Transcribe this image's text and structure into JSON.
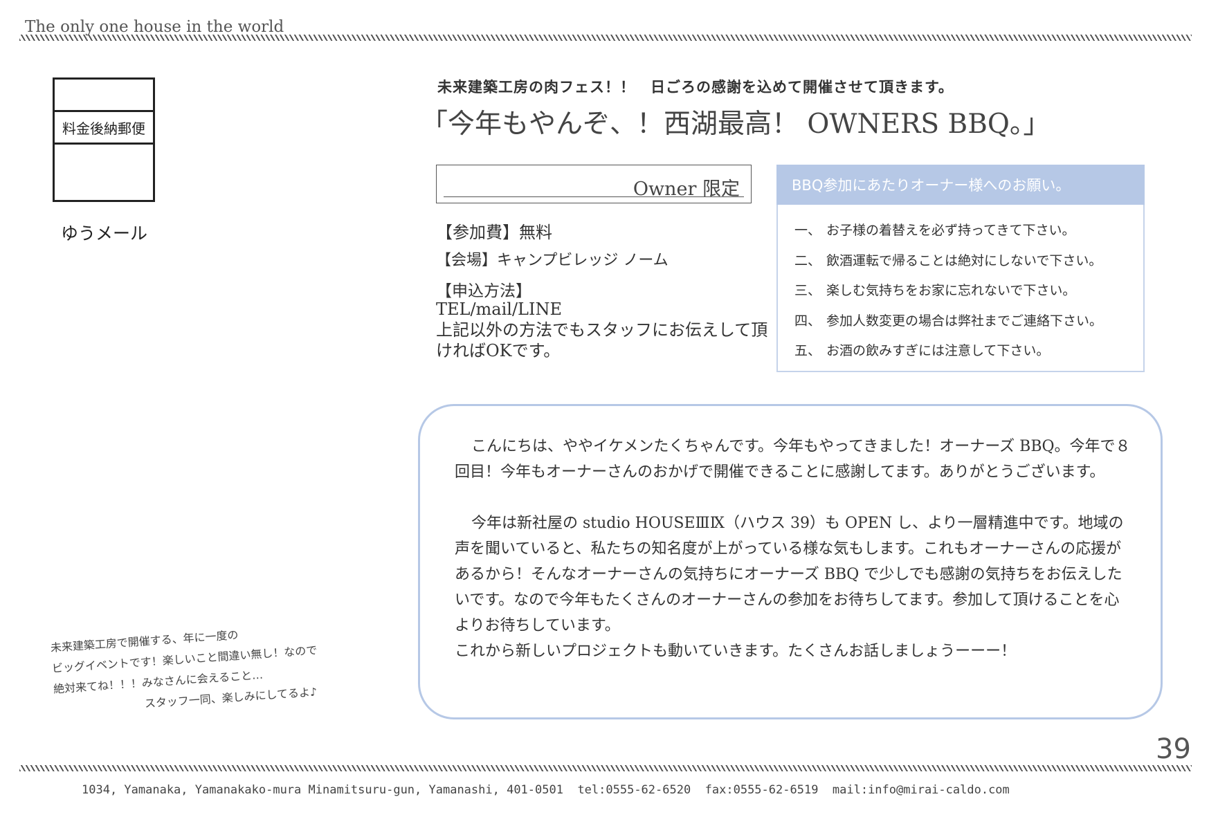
{
  "header": {
    "tagline": "The only one house in the world"
  },
  "postal": {
    "band_label": "料金後納郵便",
    "service_label": "ゆうメール"
  },
  "event": {
    "subtitle": "未来建築工房の肉フェス！！　日ごろの感謝を込めて開催させて頂きます。",
    "title": "「今年もやんぞ、！西湖最高！ OWNERS BBQ。」",
    "owner_label": "Owner 限定",
    "fee": "【参加費】無料",
    "venue": "【会場】キャンプビレッジ ノーム",
    "method_heading": "【申込方法】",
    "method_lines": [
      "TEL/mail/LINE",
      "上記以外の方法でもスタッフにお伝えして頂",
      "ければOKです。"
    ]
  },
  "requests": {
    "heading": "BBQ参加にあたりオーナー様へのお願い。",
    "items": [
      {
        "num": "一、",
        "text": "お子様の着替えを必ず持ってきて下さい。"
      },
      {
        "num": "二、",
        "text": "飲酒運転で帰ることは絶対にしないで下さい。"
      },
      {
        "num": "三、",
        "text": "楽しむ気持ちをお家に忘れないで下さい。"
      },
      {
        "num": "四、",
        "text": "参加人数変更の場合は弊社までご連絡下さい。"
      },
      {
        "num": "五、",
        "text": "お酒の飲みすぎには注意して下さい。"
      }
    ]
  },
  "message": {
    "paragraph1": "こんにちは、ややイケメンたくちゃんです。今年もやってきました！オーナーズ BBQ。今年で８回目！今年もオーナーさんのおかげで開催できることに感謝してます。ありがとうございます。",
    "paragraph2": "今年は新社屋の studio HOUSEⅢⅨ（ハウス 39）も OPEN し、より一層精進中です。地域の声を聞いていると、私たちの知名度が上がっている様な気もします。これもオーナーさんの応援があるから！そんなオーナーさんの気持ちにオーナーズ BBQ で少しでも感謝の気持ちをお伝えしたいです。なので今年もたくさんのオーナーさんの参加をお待ちしてます。参加して頂けることを心よりお待ちしています。",
    "paragraph3": "これから新しいプロジェクトも動いていきます。たくさんお話しましょうーーー！"
  },
  "handwritten": {
    "lines": [
      "未来建築工房で開催する、年に一度の",
      "ビッグイベントです！楽しいこと間違い無し！なので",
      "絶対来てね！！！みなさんに会えること…",
      "スタッフ一同、楽しみにしてるよ♪"
    ]
  },
  "page_number": "39",
  "footer": {
    "address": "1034, Yamanaka, Yamanakako-mura Minamitsuru-gun, Yamanashi, 401-0501  tel:0555-62-6520  fax:0555-62-6519  mail:info@mirai-caldo.com"
  },
  "colors": {
    "accent_blue": "#b6c8e6",
    "text": "#333333",
    "hatch": "#555555"
  }
}
